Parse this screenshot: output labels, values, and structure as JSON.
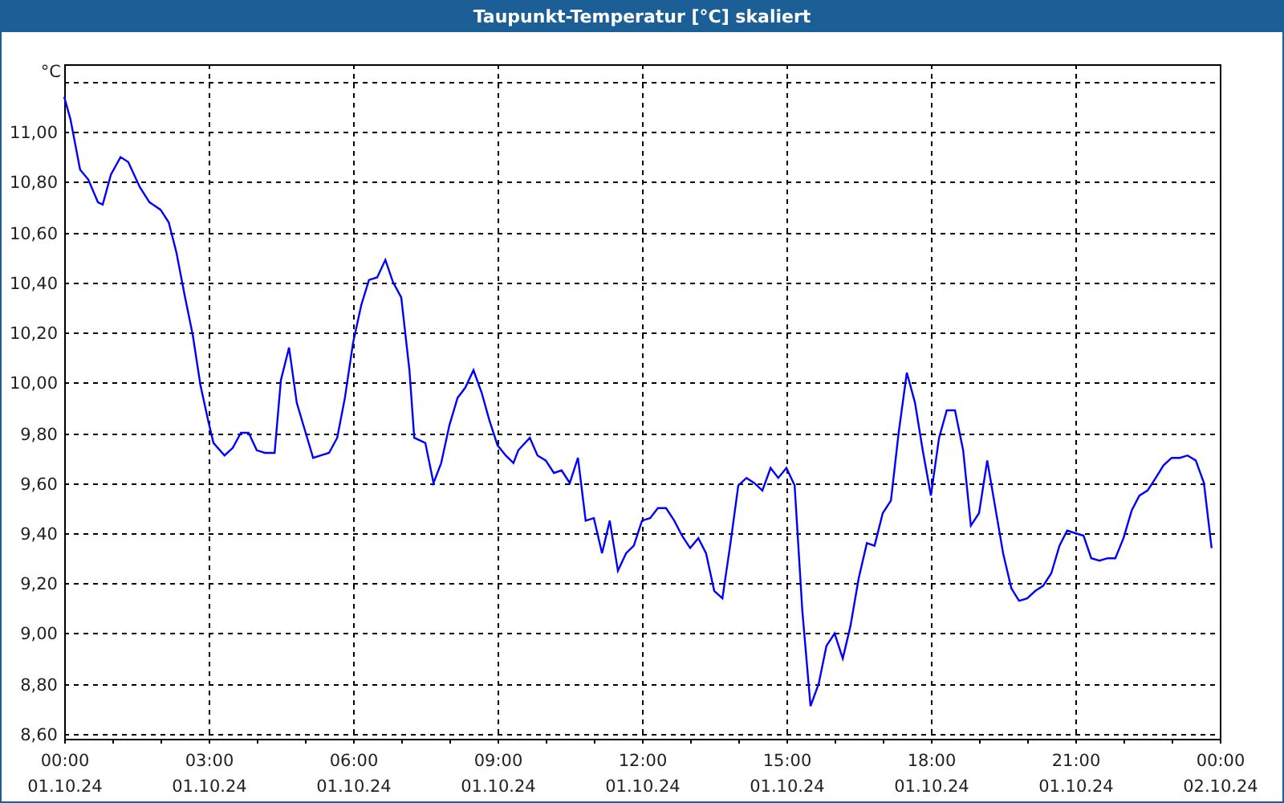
{
  "window": {
    "title": "Taupunkt-Temperatur [°C] skaliert"
  },
  "chart": {
    "date_labels": [
      "01.10.24",
      "01.10.24",
      "01.10.24",
      "01.10.24",
      "01.10.24",
      "01.10.24",
      "01.10.24",
      "01.10.24",
      "02.10.24"
    ],
    "chart_data": {
      "type": "line",
      "grid": true,
      "ylabel": "°C",
      "xlim": [
        0,
        24
      ],
      "ylim": [
        8.58,
        11.27
      ],
      "xticks": [
        {
          "value": 0,
          "label": "00:00"
        },
        {
          "value": 3,
          "label": "03:00"
        },
        {
          "value": 6,
          "label": "06:00"
        },
        {
          "value": 9,
          "label": "09:00"
        },
        {
          "value": 12,
          "label": "12:00"
        },
        {
          "value": 15,
          "label": "15:00"
        },
        {
          "value": 18,
          "label": "18:00"
        },
        {
          "value": 21,
          "label": "21:00"
        },
        {
          "value": 24,
          "label": "00:00"
        }
      ],
      "yticks": [
        {
          "value": 8.6,
          "label": "8,60"
        },
        {
          "value": 8.8,
          "label": "8,80"
        },
        {
          "value": 9.0,
          "label": "9,00"
        },
        {
          "value": 9.2,
          "label": "9,20"
        },
        {
          "value": 9.4,
          "label": "9,40"
        },
        {
          "value": 9.6,
          "label": "9,60"
        },
        {
          "value": 9.8,
          "label": "9,80"
        },
        {
          "value": 10.0,
          "label": "10,00"
        },
        {
          "value": 10.2,
          "label": "10,20"
        },
        {
          "value": 10.4,
          "label": "10,40"
        },
        {
          "value": 10.6,
          "label": "10,60"
        },
        {
          "value": 10.8,
          "label": "10,80"
        },
        {
          "value": 11.0,
          "label": "11,00"
        }
      ],
      "x": [
        0,
        0.13,
        0.33,
        0.5,
        0.7,
        0.8,
        0.97,
        1.17,
        1.33,
        1.57,
        1.77,
        2,
        2.17,
        2.33,
        2.5,
        2.67,
        2.83,
        3,
        3.1,
        3.33,
        3.5,
        3.67,
        3.83,
        4,
        4.17,
        4.37,
        4.5,
        4.67,
        4.83,
        5,
        5.17,
        5.33,
        5.5,
        5.67,
        5.83,
        6,
        6.17,
        6.33,
        6.5,
        6.67,
        6.83,
        7,
        7.17,
        7.27,
        7.5,
        7.67,
        7.83,
        8,
        8.17,
        8.33,
        8.5,
        8.67,
        8.83,
        9,
        9.17,
        9.33,
        9.43,
        9.67,
        9.83,
        10,
        10.17,
        10.33,
        10.5,
        10.67,
        10.83,
        11,
        11.17,
        11.33,
        11.5,
        11.67,
        11.83,
        12,
        12.17,
        12.33,
        12.5,
        12.67,
        12.83,
        13,
        13.17,
        13.33,
        13.5,
        13.67,
        13.83,
        14,
        14.17,
        14.33,
        14.5,
        14.67,
        14.83,
        15,
        15.17,
        15.33,
        15.5,
        15.67,
        15.83,
        16,
        16.17,
        16.33,
        16.5,
        16.67,
        16.83,
        17,
        17.17,
        17.33,
        17.5,
        17.67,
        17.83,
        18,
        18.17,
        18.33,
        18.5,
        18.67,
        18.83,
        19,
        19.17,
        19.33,
        19.5,
        19.67,
        19.83,
        20,
        20.17,
        20.33,
        20.5,
        20.67,
        20.83,
        21,
        21.17,
        21.33,
        21.5,
        21.67,
        21.83,
        22,
        22.17,
        22.33,
        22.5,
        22.67,
        22.83,
        23,
        23.17,
        23.33,
        23.5,
        23.67,
        23.83
      ],
      "series": [
        {
          "color": "#0000ff",
          "values": [
            11.14,
            11.05,
            10.85,
            10.81,
            10.72,
            10.71,
            10.83,
            10.9,
            10.88,
            10.78,
            10.72,
            10.69,
            10.64,
            10.52,
            10.35,
            10.19,
            9.99,
            9.84,
            9.76,
            9.71,
            9.74,
            9.8,
            9.8,
            9.73,
            9.72,
            9.72,
            10.01,
            10.14,
            9.92,
            9.81,
            9.7,
            9.71,
            9.72,
            9.78,
            9.94,
            10.16,
            10.31,
            10.41,
            10.42,
            10.49,
            10.4,
            10.34,
            10.05,
            9.78,
            9.76,
            9.6,
            9.68,
            9.83,
            9.94,
            9.98,
            10.05,
            9.96,
            9.85,
            9.75,
            9.71,
            9.68,
            9.73,
            9.78,
            9.71,
            9.69,
            9.64,
            9.65,
            9.6,
            9.7,
            9.45,
            9.46,
            9.32,
            9.45,
            9.25,
            9.32,
            9.35,
            9.45,
            9.46,
            9.5,
            9.5,
            9.45,
            9.39,
            9.34,
            9.38,
            9.32,
            9.17,
            9.14,
            9.35,
            9.59,
            9.62,
            9.6,
            9.57,
            9.66,
            9.62,
            9.66,
            9.59,
            9.09,
            8.71,
            8.8,
            8.95,
            9.0,
            8.9,
            9.03,
            9.22,
            9.36,
            9.35,
            9.48,
            9.53,
            9.8,
            10.04,
            9.92,
            9.73,
            9.55,
            9.78,
            9.89,
            9.89,
            9.73,
            9.43,
            9.48,
            9.69,
            9.51,
            9.32,
            9.18,
            9.13,
            9.14,
            9.17,
            9.19,
            9.24,
            9.35,
            9.41,
            9.4,
            9.39,
            9.3,
            9.29,
            9.3,
            9.3,
            9.38,
            9.49,
            9.55,
            9.57,
            9.62,
            9.67,
            9.7,
            9.7,
            9.71,
            9.69,
            9.6,
            9.34
          ]
        }
      ]
    }
  }
}
